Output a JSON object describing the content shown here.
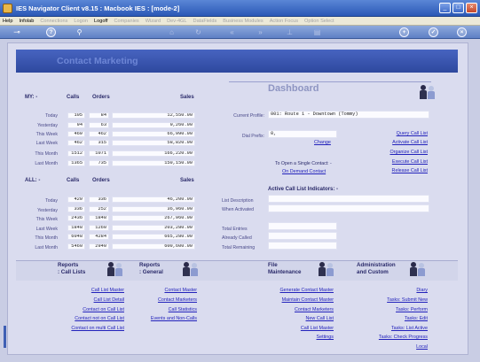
{
  "window": {
    "title": "IES Navigator Client v8.15 : Macbook IES : [mode-2]",
    "buttons": [
      "_",
      "□",
      "×"
    ]
  },
  "menu": {
    "items": [
      {
        "label": "Help",
        "enabled": true
      },
      {
        "label": "Infolab",
        "enabled": true
      },
      {
        "label": "Connections",
        "enabled": false
      },
      {
        "label": "Logon",
        "enabled": false
      },
      {
        "label": "Logoff",
        "enabled": true
      },
      {
        "label": "Companies",
        "enabled": false
      },
      {
        "label": "Wizard",
        "enabled": false
      },
      {
        "label": "Dev-4GL",
        "enabled": false
      },
      {
        "label": "DataFields",
        "enabled": false
      },
      {
        "label": "Business Modules",
        "enabled": false
      },
      {
        "label": "Action Focus",
        "enabled": false
      },
      {
        "label": "Option Select",
        "enabled": false
      }
    ]
  },
  "toolbar": {
    "icons": [
      "key-icon",
      "help-icon",
      "search-icon",
      "home-icon",
      "refresh-icon",
      "rewind-icon",
      "fast-forward-icon",
      "pin-icon",
      "save-icon",
      "add-icon",
      "confirm-icon",
      "cancel-icon"
    ],
    "glyphs": {
      "key": "⊸",
      "help": "?",
      "search": "⚲",
      "home": "⌂",
      "refresh": "↻",
      "rewind": "«",
      "ff": "»",
      "pin": "⊥",
      "save": "▤",
      "add": "+",
      "confirm": "✓",
      "cancel": "×"
    }
  },
  "banner": {
    "title": "Contact Marketing"
  },
  "my_stats": {
    "heading": "MY: -",
    "col_calls": "Calls",
    "col_orders": "Orders",
    "col_sales": "Sales",
    "rows": [
      {
        "label": "Today",
        "calls": "105",
        "orders": "84",
        "sales": "12,550.00"
      },
      {
        "label": "Yesterday",
        "calls": "94",
        "orders": "63",
        "sales": "9,260.00"
      },
      {
        "label": "This Week",
        "calls": "469",
        "orders": "462",
        "sales": "66,990.00"
      },
      {
        "label": "Last Week",
        "calls": "462",
        "orders": "315",
        "sales": "58,820.00"
      },
      {
        "label": "This Month",
        "calls": "1512",
        "orders": "1071",
        "sales": "166,220.00"
      },
      {
        "label": "Last Month",
        "calls": "1365",
        "orders": "735",
        "sales": "150,150.00"
      }
    ]
  },
  "all_stats": {
    "heading": "ALL: -",
    "col_calls": "Calls",
    "col_orders": "Orders",
    "col_sales": "Sales",
    "rows": [
      {
        "label": "Today",
        "calls": "420",
        "orders": "336",
        "sales": "46,200.00"
      },
      {
        "label": "Yesterday",
        "calls": "336",
        "orders": "252",
        "sales": "36,960.00"
      },
      {
        "label": "This Week",
        "calls": "2436",
        "orders": "1848",
        "sales": "267,960.00"
      },
      {
        "label": "Last Week",
        "calls": "1848",
        "orders": "1260",
        "sales": "203,280.00"
      },
      {
        "label": "This Month",
        "calls": "6048",
        "orders": "4284",
        "sales": "665,280.00"
      },
      {
        "label": "Last Month",
        "calls": "5460",
        "orders": "2940",
        "sales": "600,600.00"
      }
    ]
  },
  "dashboard": {
    "title": "Dashboard",
    "current_profile_label": "Current Profile:",
    "current_profile_value": "001: Route 1 - Downtown (Tommy)",
    "dial_prefix_label": "Dial Prefix:",
    "dial_prefix_value": "0,",
    "change_link": "Change",
    "open_contact_text": "To Open a Single Contact: -",
    "on_demand_link": "On Demand Contact",
    "links": [
      "Query Call List",
      "Activate Call List",
      "Organize Call List",
      "Execute Call List",
      "Release Call List"
    ]
  },
  "active_indicators": {
    "heading": "Active Call List Indicators: -",
    "list_description_label": "List Description",
    "when_activated_label": "When Activated",
    "total_entries_label": "Total Entries",
    "already_called_label": "Already Called",
    "total_remaining_label": "Total Remaining",
    "list_description_value": "",
    "when_activated_value": "",
    "total_entries_value": "",
    "already_called_value": "",
    "total_remaining_value": ""
  },
  "groups": {
    "reports_calls": {
      "line1": "Reports",
      "line2": ": Call Lists"
    },
    "reports_general": {
      "line1": "Reports",
      "line2": ": General"
    },
    "file_maintenance": {
      "line1": "File",
      "line2": "Maintenance"
    },
    "administration": {
      "line1": "Administration",
      "line2": "and Custom"
    }
  },
  "links": {
    "reports_calls": [
      "Call List Master",
      "Call List Detail",
      "Contact on Call List",
      "Contact not on Call List",
      "Contact on multi Call List"
    ],
    "reports_general": [
      "Contact Master",
      "Contact Marketers",
      "Call Statistics",
      "Events and Non-Calls"
    ],
    "file_maintenance": [
      "Generate Contact Master",
      "Maintain Contact Master",
      "Contact Marketers",
      "New Call List",
      "Call List Master",
      "Settings"
    ],
    "administration": [
      "Diary",
      "Tasks: Submit New",
      "Tasks: Perform",
      "Tasks: Edit",
      "Tasks: List Active",
      "Tasks: Check Progress",
      "Local"
    ]
  }
}
